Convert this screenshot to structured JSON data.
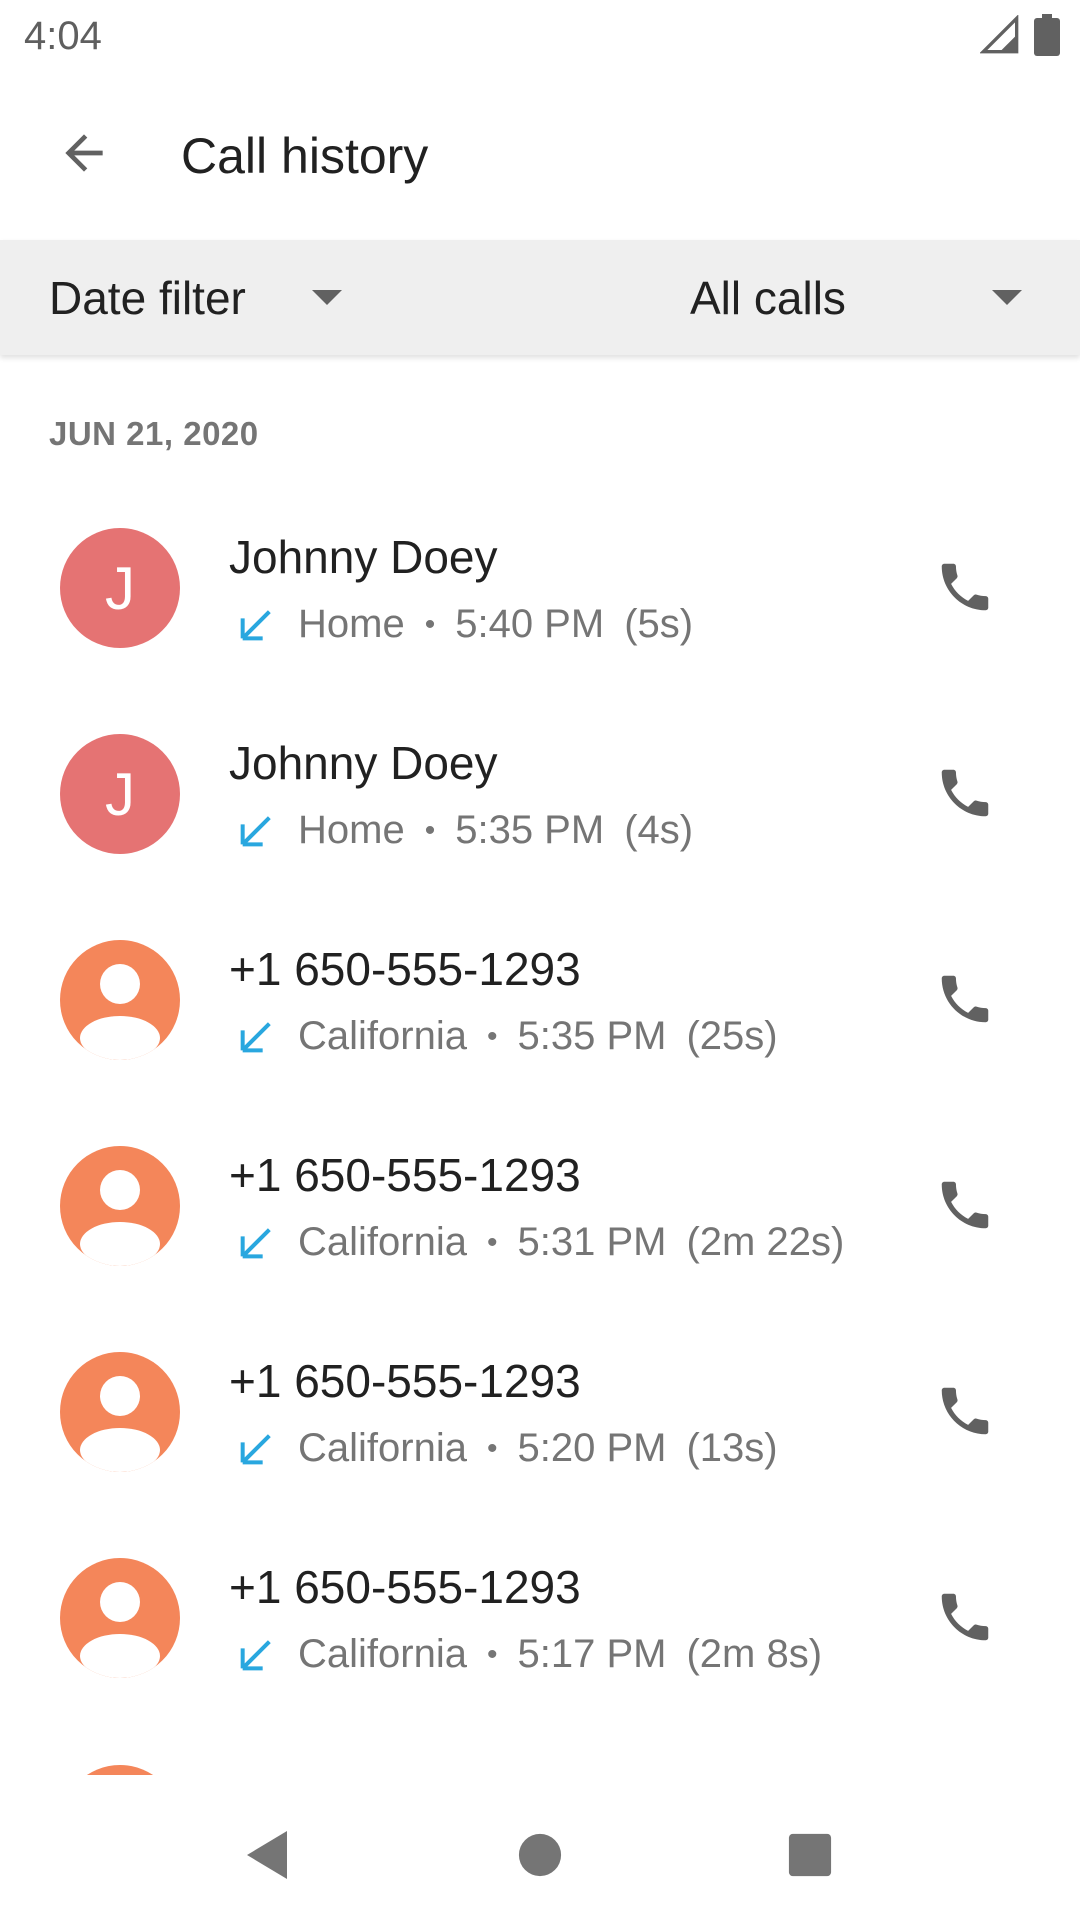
{
  "status_bar": {
    "time": "4:04",
    "icons": [
      "signal-icon",
      "battery-icon"
    ]
  },
  "app_bar": {
    "title": "Call history",
    "back_icon": "arrow-back-icon"
  },
  "filters": {
    "date_filter": "Date filter",
    "call_type": "All calls"
  },
  "section": {
    "date_header": "JUN 21, 2020"
  },
  "colors": {
    "incoming_arrow": "#29a7df",
    "avatar_contact": "#e57373",
    "avatar_unknown": "#f4865a",
    "icon_gray": "#616161"
  },
  "calls": [
    {
      "name": "Johnny Doey",
      "avatar": "J",
      "avatar_type": "letter",
      "label": "Home",
      "time": "5:40 PM",
      "duration": "(5s)",
      "direction": "incoming"
    },
    {
      "name": "Johnny Doey",
      "avatar": "J",
      "avatar_type": "letter",
      "label": "Home",
      "time": "5:35 PM",
      "duration": "(4s)",
      "direction": "incoming"
    },
    {
      "name": "+1 650-555-1293",
      "avatar": "",
      "avatar_type": "person",
      "label": "California",
      "time": "5:35 PM",
      "duration": "(25s)",
      "direction": "incoming"
    },
    {
      "name": "+1 650-555-1293",
      "avatar": "",
      "avatar_type": "person",
      "label": "California",
      "time": "5:31 PM",
      "duration": "(2m 22s)",
      "direction": "incoming"
    },
    {
      "name": "+1 650-555-1293",
      "avatar": "",
      "avatar_type": "person",
      "label": "California",
      "time": "5:20 PM",
      "duration": "(13s)",
      "direction": "incoming"
    },
    {
      "name": "+1 650-555-1293",
      "avatar": "",
      "avatar_type": "person",
      "label": "California",
      "time": "5:17 PM",
      "duration": "(2m 8s)",
      "direction": "incoming"
    }
  ],
  "nav_bar": {
    "icons": [
      "back-triangle-icon",
      "home-circle-icon",
      "recents-square-icon"
    ]
  }
}
